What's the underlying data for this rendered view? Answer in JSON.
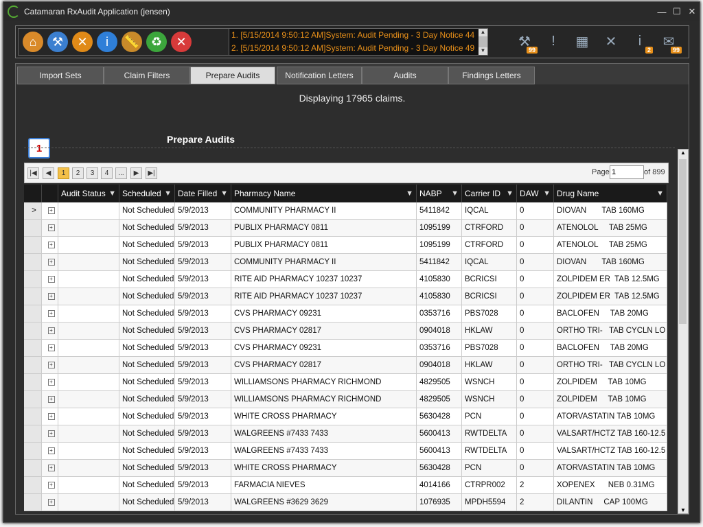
{
  "app": {
    "title": "Catamaran RxAudit Application (jensen)"
  },
  "window_controls": {
    "minimize": "—",
    "maximize": "☐",
    "close": "✕"
  },
  "toolbar": {
    "left_icons": [
      {
        "name": "home-icon",
        "glyph": "⌂",
        "color": "#d98a2a"
      },
      {
        "name": "tools-icon",
        "glyph": "⚒",
        "color": "#3b7fd0"
      },
      {
        "name": "cross-tools-icon",
        "glyph": "✕",
        "color": "#e08a18"
      },
      {
        "name": "info-icon",
        "glyph": "i",
        "color": "#2f7fd8"
      },
      {
        "name": "ruler-icon",
        "glyph": "📏",
        "color": "#c98a2a"
      },
      {
        "name": "refresh-icon",
        "glyph": "♻",
        "color": "#3ca63c"
      },
      {
        "name": "close-icon",
        "glyph": "✕",
        "color": "#d83a3a"
      }
    ],
    "log_lines": [
      "1. [5/15/2014 9:50:12 AM]System: Audit Pending - 3 Day Notice 44",
      "2. [5/15/2014 9:50:12 AM]System: Audit Pending - 3 Day Notice 49"
    ],
    "right_icons": [
      {
        "name": "tools-badge-icon",
        "glyph": "⚒",
        "badge": "99"
      },
      {
        "name": "alert-icon",
        "glyph": "!",
        "badge": ""
      },
      {
        "name": "calendar-icon",
        "glyph": "▦",
        "badge": ""
      },
      {
        "name": "cancel-icon",
        "glyph": "✕",
        "badge": ""
      },
      {
        "name": "info-badge-icon",
        "glyph": "i",
        "badge": "2"
      },
      {
        "name": "mail-badge-icon",
        "glyph": "✉",
        "badge": "99"
      }
    ]
  },
  "tabs": [
    {
      "label": "Import Sets",
      "active": false
    },
    {
      "label": "Claim Filters",
      "active": false
    },
    {
      "label": "Prepare Audits",
      "active": true
    },
    {
      "label": "Notification Letters",
      "active": false
    },
    {
      "label": "Audits",
      "active": false
    },
    {
      "label": "Findings Letters",
      "active": false
    }
  ],
  "main": {
    "status": "Displaying 17965 claims.",
    "section_title": "Prepare Audits",
    "step_number": "1"
  },
  "pager": {
    "pages": [
      "1",
      "2",
      "3",
      "4",
      "..."
    ],
    "current_page": "1",
    "page_label": "Page",
    "page_value": "1",
    "of_label": "of 899"
  },
  "grid": {
    "columns": [
      "Audit Status",
      "Scheduled",
      "Date Filled",
      "Pharmacy Name",
      "NABP",
      "Carrier ID",
      "DAW",
      "Drug Name"
    ],
    "rows": [
      [
        "",
        "Not Scheduled",
        "5/9/2013",
        "COMMUNITY PHARMACY II",
        "5411842",
        "IQCAL",
        "0",
        "DIOVAN       TAB 160MG"
      ],
      [
        "",
        "Not Scheduled",
        "5/9/2013",
        "PUBLIX PHARMACY 0811",
        "1095199",
        "CTRFORD",
        "0",
        "ATENOLOL     TAB 25MG"
      ],
      [
        "",
        "Not Scheduled",
        "5/9/2013",
        "PUBLIX PHARMACY 0811",
        "1095199",
        "CTRFORD",
        "0",
        "ATENOLOL     TAB 25MG"
      ],
      [
        "",
        "Not Scheduled",
        "5/9/2013",
        "COMMUNITY PHARMACY II",
        "5411842",
        "IQCAL",
        "0",
        "DIOVAN       TAB 160MG"
      ],
      [
        "",
        "Not Scheduled",
        "5/9/2013",
        "RITE AID PHARMACY 10237 10237",
        "4105830",
        "BCRICSI",
        "0",
        "ZOLPIDEM ER  TAB 12.5MG"
      ],
      [
        "",
        "Not Scheduled",
        "5/9/2013",
        "RITE AID PHARMACY 10237 10237",
        "4105830",
        "BCRICSI",
        "0",
        "ZOLPIDEM ER  TAB 12.5MG"
      ],
      [
        "",
        "Not Scheduled",
        "5/9/2013",
        "CVS PHARMACY 09231",
        "0353716",
        "PBS7028",
        "0",
        "BACLOFEN     TAB 20MG"
      ],
      [
        "",
        "Not Scheduled",
        "5/9/2013",
        "CVS PHARMACY 02817",
        "0904018",
        "HKLAW",
        "0",
        "ORTHO TRI-   TAB CYCLN LO"
      ],
      [
        "",
        "Not Scheduled",
        "5/9/2013",
        "CVS PHARMACY 09231",
        "0353716",
        "PBS7028",
        "0",
        "BACLOFEN     TAB 20MG"
      ],
      [
        "",
        "Not Scheduled",
        "5/9/2013",
        "CVS PHARMACY 02817",
        "0904018",
        "HKLAW",
        "0",
        "ORTHO TRI-   TAB CYCLN LO"
      ],
      [
        "",
        "Not Scheduled",
        "5/9/2013",
        "WILLIAMSONS PHARMACY RICHMOND",
        "4829505",
        "WSNCH",
        "0",
        "ZOLPIDEM     TAB 10MG"
      ],
      [
        "",
        "Not Scheduled",
        "5/9/2013",
        "WILLIAMSONS PHARMACY RICHMOND",
        "4829505",
        "WSNCH",
        "0",
        "ZOLPIDEM     TAB 10MG"
      ],
      [
        "",
        "Not Scheduled",
        "5/9/2013",
        "WHITE CROSS PHARMACY",
        "5630428",
        "PCN",
        "0",
        "ATORVASTATIN TAB 10MG"
      ],
      [
        "",
        "Not Scheduled",
        "5/9/2013",
        "WALGREENS #7433 7433",
        "5600413",
        "RWTDELTA",
        "0",
        "VALSART/HCTZ TAB 160-12.5"
      ],
      [
        "",
        "Not Scheduled",
        "5/9/2013",
        "WALGREENS #7433 7433",
        "5600413",
        "RWTDELTA",
        "0",
        "VALSART/HCTZ TAB 160-12.5"
      ],
      [
        "",
        "Not Scheduled",
        "5/9/2013",
        "WHITE CROSS PHARMACY",
        "5630428",
        "PCN",
        "0",
        "ATORVASTATIN TAB 10MG"
      ],
      [
        "",
        "Not Scheduled",
        "5/9/2013",
        "FARMACIA NIEVES",
        "4014166",
        "CTRPR002",
        "2",
        "XOPENEX      NEB 0.31MG"
      ],
      [
        "",
        "Not Scheduled",
        "5/9/2013",
        "WALGREENS #3629 3629",
        "1076935",
        "MPDH5594",
        "2",
        "DILANTIN     CAP 100MG"
      ]
    ]
  }
}
